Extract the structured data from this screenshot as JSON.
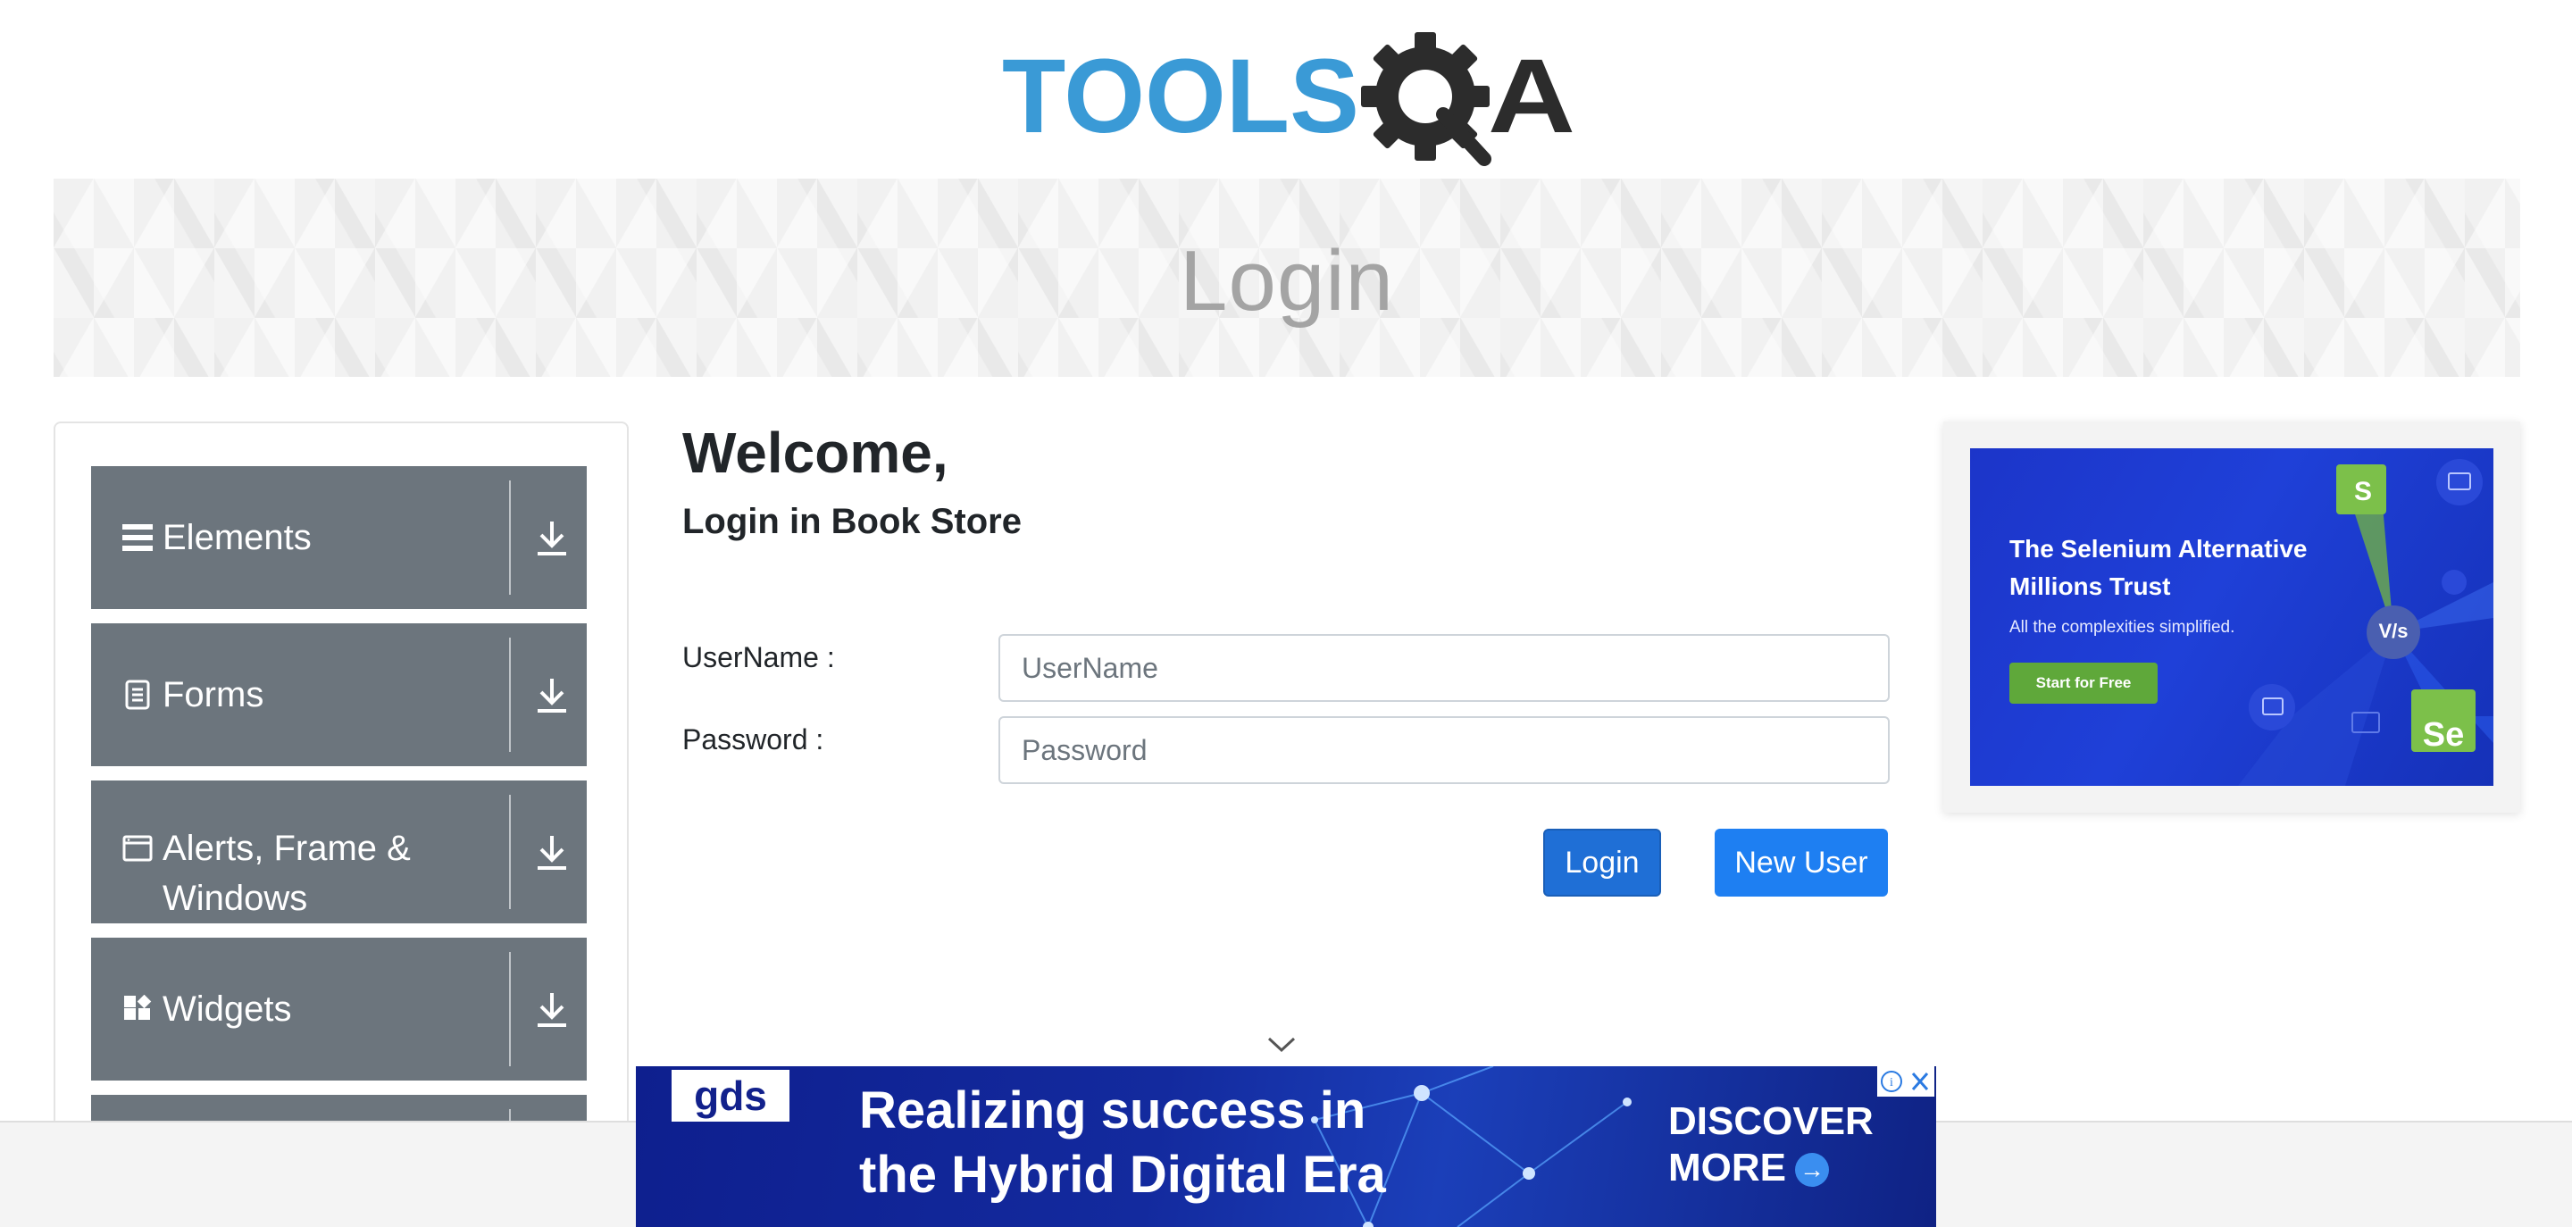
{
  "logo": {
    "text": "TOOLSQA"
  },
  "banner": {
    "title": "Login"
  },
  "sidebar": {
    "groups": [
      {
        "label": "Elements",
        "icon": "hamburger-icon"
      },
      {
        "label": "Forms",
        "icon": "document-icon"
      },
      {
        "label": "Alerts, Frame & Windows",
        "icon": "window-icon"
      },
      {
        "label": "Widgets",
        "icon": "widgets-icon"
      }
    ]
  },
  "main": {
    "welcome": "Welcome,",
    "subtitle": "Login in Book Store",
    "username": {
      "label": "UserName :",
      "placeholder": "UserName",
      "value": ""
    },
    "password": {
      "label": "Password :",
      "placeholder": "Password",
      "value": ""
    },
    "login_button": "Login",
    "new_user_button": "New User"
  },
  "side_ad": {
    "headline": "The Selenium Alternative Millions Trust",
    "subline": "All the complexities simplified.",
    "cta": "Start for Free",
    "badge_left": "S",
    "badge_right": "Se",
    "vs": "V/s"
  },
  "bottom_ad": {
    "brand": "gds",
    "headline_line1": "Realizing success in",
    "headline_line2": "the Hybrid Digital Era",
    "cta_line1": "DISCOVER",
    "cta_line2": "MORE"
  },
  "colors": {
    "sidebar_group": "#6c757d",
    "primary": "#1e7ff2",
    "banner_title": "#a4a4a4",
    "logo_blue": "#3a9ad6",
    "logo_dark": "#2c2c2c"
  }
}
